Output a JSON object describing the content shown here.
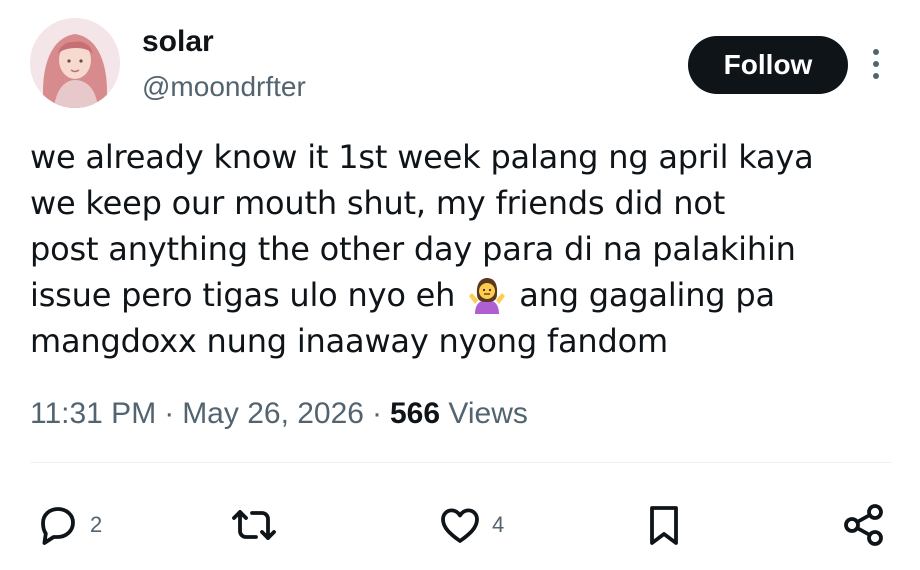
{
  "user": {
    "display_name": "solar",
    "handle": "@moondrfter",
    "avatar_icon": "profile-photo"
  },
  "header": {
    "follow_label": "Follow",
    "more_icon": "more-vertical-icon"
  },
  "tweet": {
    "lines": [
      "we already know it 1st week palang ng april kaya",
      "we keep our mouth shut, my friends did not",
      "post anything the other day para di na palakihin"
    ],
    "line4_before_emoji": "issue pero tigas ulo nyo eh",
    "emoji": "woman-shrugging",
    "line4_after_emoji": "ang gagaling pa",
    "line5": "mangdoxx nung inaaway nyong fandom"
  },
  "meta": {
    "time": "11:31 PM",
    "separator": "·",
    "date": "May 26, 2026",
    "views_count": "566",
    "views_label": "Views"
  },
  "actions": {
    "reply_count": "2",
    "retweet_count": "",
    "like_count": "4"
  },
  "colors": {
    "text": "#0f1419",
    "secondary": "#536471",
    "follow_bg": "#0f1419",
    "divider": "#eff3f4"
  }
}
